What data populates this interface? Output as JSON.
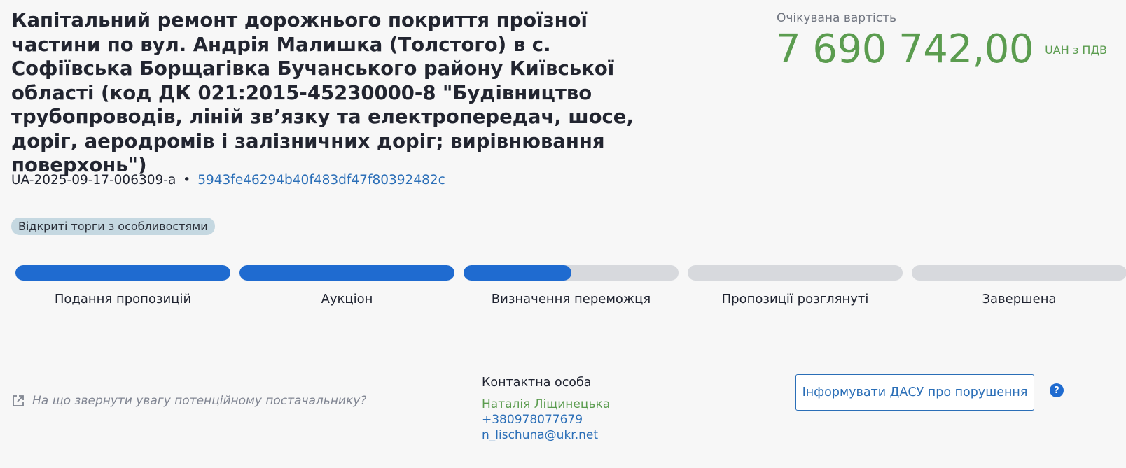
{
  "tender": {
    "title": "Капітальний ремонт дорожнього покриття проїзної частини по вул. Андрія Малишка (Толстого) в с. Софіївська Борщагівка Бучанського району Київської області (код ДК 021:2015-45230000-8 \"Будівництво трубопроводів, ліній зв’язку та електропередач, шосе, доріг, аеродромів і залізничних доріг; вирівнювання поверхонь\")",
    "code": "UA-2025-09-17-006309-a",
    "separator": "•",
    "hash": "5943fe46294b40f483df47f80392482c",
    "procedure_type": "Відкриті торги з особливостями"
  },
  "expected_value": {
    "label": "Очікувана вартість",
    "amount": "7 690 742,00",
    "currency": "UAH з ПДВ"
  },
  "stages": [
    {
      "label": "Подання пропозицій",
      "progress": 1.0
    },
    {
      "label": "Аукціон",
      "progress": 1.0
    },
    {
      "label": "Визначення переможця",
      "progress": 0.5
    },
    {
      "label": "Пропозиції розглянуті",
      "progress": 0.0
    },
    {
      "label": "Завершена",
      "progress": 0.0
    }
  ],
  "hint": {
    "icon": "external-link-icon",
    "text": "На що звернути увагу потенційному постачальнику?"
  },
  "contact": {
    "title": "Контактна особа",
    "name": "Наталія Ліщинецька",
    "phone": "+380978077679",
    "email": "n_lischuna@ukr.net"
  },
  "actions": {
    "report_label": "Інформувати ДАСУ про порушення",
    "help_icon": "question-icon",
    "help_glyph": "?"
  },
  "colors": {
    "accent_blue": "#1f6bd0",
    "link_blue": "#2a6eb7",
    "value_green": "#5b9c4f",
    "track_gray": "#d7d9dd"
  }
}
